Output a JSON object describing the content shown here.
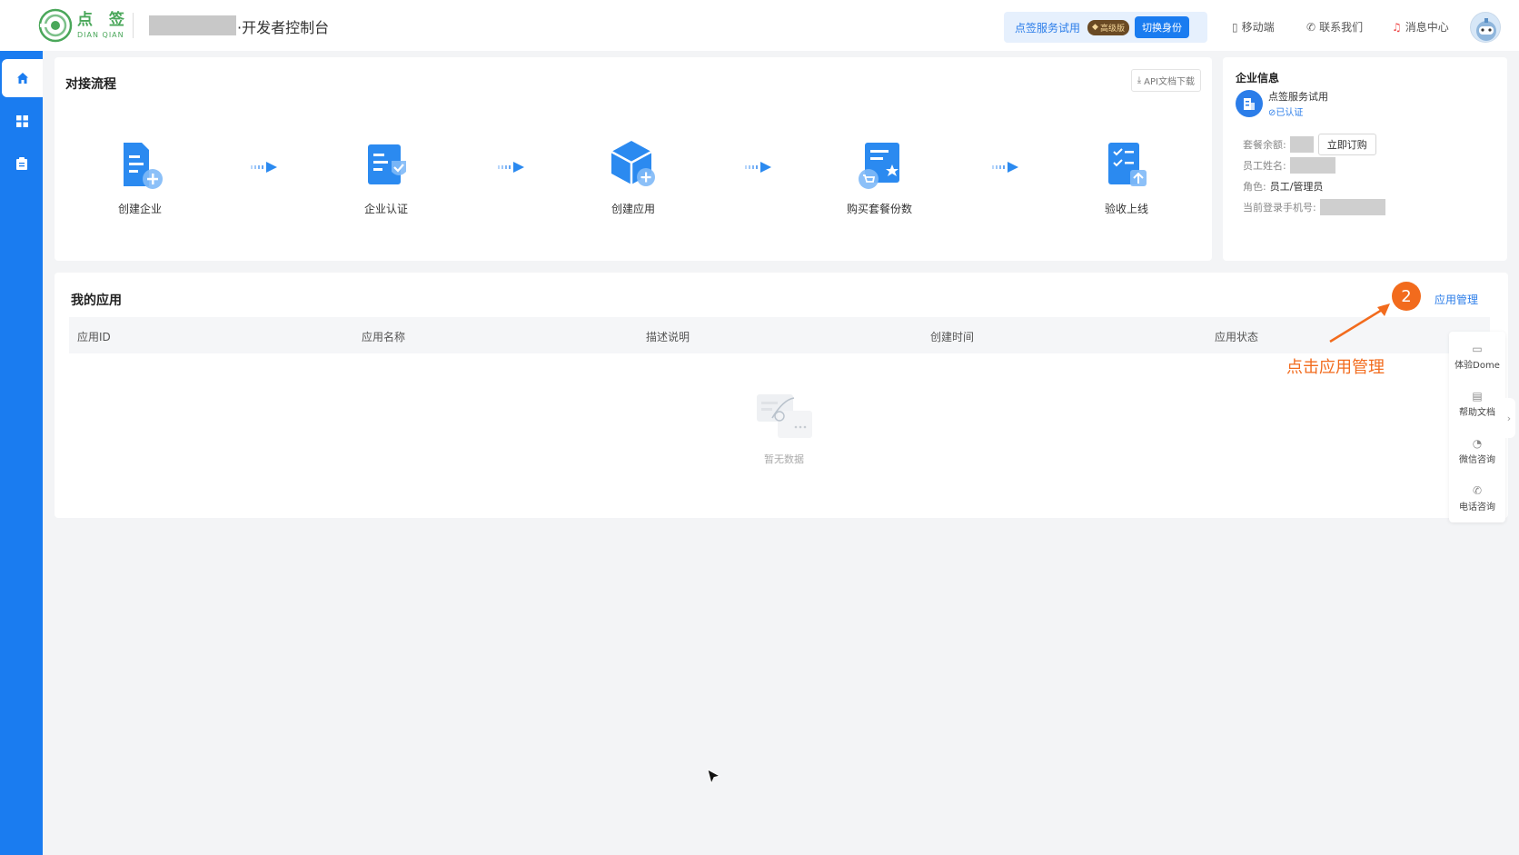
{
  "header": {
    "logo_cn": "点 签",
    "logo_en": "DIAN QIAN",
    "console_title": "·开发者控制台",
    "trial_name": "点签服务试用",
    "vip_label": "高级版",
    "switch_identity": "切换身份",
    "mobile": "移动端",
    "contact": "联系我们",
    "messages": "消息中心"
  },
  "flow": {
    "title": "对接流程",
    "api_download": "API文档下载",
    "steps": [
      {
        "label": "创建企业",
        "icon": "create-enterprise-icon"
      },
      {
        "label": "企业认证",
        "icon": "enterprise-verify-icon"
      },
      {
        "label": "创建应用",
        "icon": "create-app-icon"
      },
      {
        "label": "购买套餐份数",
        "icon": "buy-package-icon"
      },
      {
        "label": "验收上线",
        "icon": "acceptance-online-icon"
      }
    ]
  },
  "enterprise": {
    "title": "企业信息",
    "name": "点签服务试用",
    "cert": "⊘已认证",
    "package_balance_label": "套餐余额:",
    "buy_now": "立即订购",
    "employee_name_label": "员工姓名:",
    "role_label": "角色:",
    "role_value": "员工/管理员",
    "phone_label": "当前登录手机号:"
  },
  "apps": {
    "title": "我的应用",
    "manage_link": "应用管理",
    "columns": [
      "应用ID",
      "应用名称",
      "描述说明",
      "创建时间",
      "应用状态"
    ],
    "empty_text": "暂无数据"
  },
  "annotation": {
    "step_number": "2",
    "text": "点击应用管理",
    "color": "#f26b1d"
  },
  "float_tools": {
    "items": [
      {
        "label": "体验Dome",
        "icon": "demo-icon"
      },
      {
        "label": "帮助文档",
        "icon": "doc-icon"
      },
      {
        "label": "微信咨询",
        "icon": "wechat-icon"
      },
      {
        "label": "电话咨询",
        "icon": "phone-icon"
      }
    ]
  },
  "colors": {
    "primary": "#1a7cf0",
    "brand_green": "#4aa75a"
  }
}
